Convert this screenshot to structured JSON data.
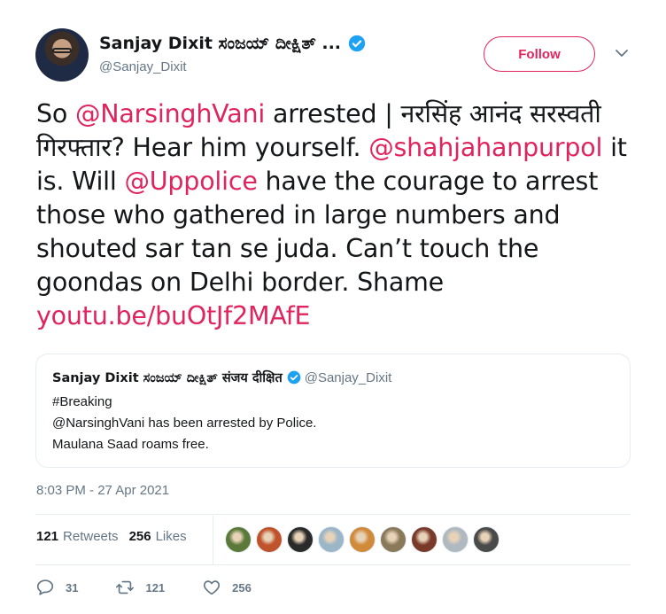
{
  "author": {
    "display_name": "Sanjay Dixit ಸಂಜಯ್ ದೀಕ್ಷಿತ್ ...",
    "handle": "@Sanjay_Dixit"
  },
  "follow_label": "Follow",
  "tweet": {
    "parts": [
      {
        "text": "So ",
        "link": false
      },
      {
        "text": "@NarsinghVani",
        "link": true
      },
      {
        "text": " arrested | नरसिंह आनंद सरस्वती गिरफ्तार? Hear him yourself. ",
        "link": false
      },
      {
        "text": "@shahjahanpurpol",
        "link": true
      },
      {
        "text": " it is. Will ",
        "link": false
      },
      {
        "text": "@Uppolice",
        "link": true
      },
      {
        "text": " have the courage to arrest those who gathered in large numbers and shouted sar tan se juda. Can’t touch the goondas on Delhi border. Shame ",
        "link": false
      },
      {
        "text": "youtu.be/buOtJf2MAfE",
        "link": true
      }
    ]
  },
  "quoted": {
    "display_name": "Sanjay Dixit ಸಂಜಯ್ ದೀಕ್ಷಿತ್ संजय दीक्षित",
    "handle": "@Sanjay_Dixit",
    "lines": [
      "#Breaking",
      "@NarsinghVani has been arrested by Police.",
      "Maulana Saad roams free."
    ]
  },
  "timestamp": "8:03 PM - 27 Apr 2021",
  "stats": {
    "retweets_count": "121",
    "retweets_label": "Retweets",
    "likes_count": "256",
    "likes_label": "Likes"
  },
  "liker_avatar_colors": [
    "#5b7a3a",
    "#c0532b",
    "#2a2a2a",
    "#9bb5c9",
    "#d08a3a",
    "#8a7a5a",
    "#7a3a2a",
    "#b0b8c0",
    "#4a4a4a"
  ],
  "actions": {
    "reply_count": "31",
    "retweet_count": "121",
    "like_count": "256"
  },
  "colors": {
    "accent": "#e0245e",
    "secondary_text": "#657786",
    "verified": "#1da1f2"
  },
  "icons": {
    "verified": "verified-badge-icon",
    "chevron": "chevron-down-icon",
    "reply": "reply-icon",
    "retweet": "retweet-icon",
    "like": "heart-icon"
  }
}
